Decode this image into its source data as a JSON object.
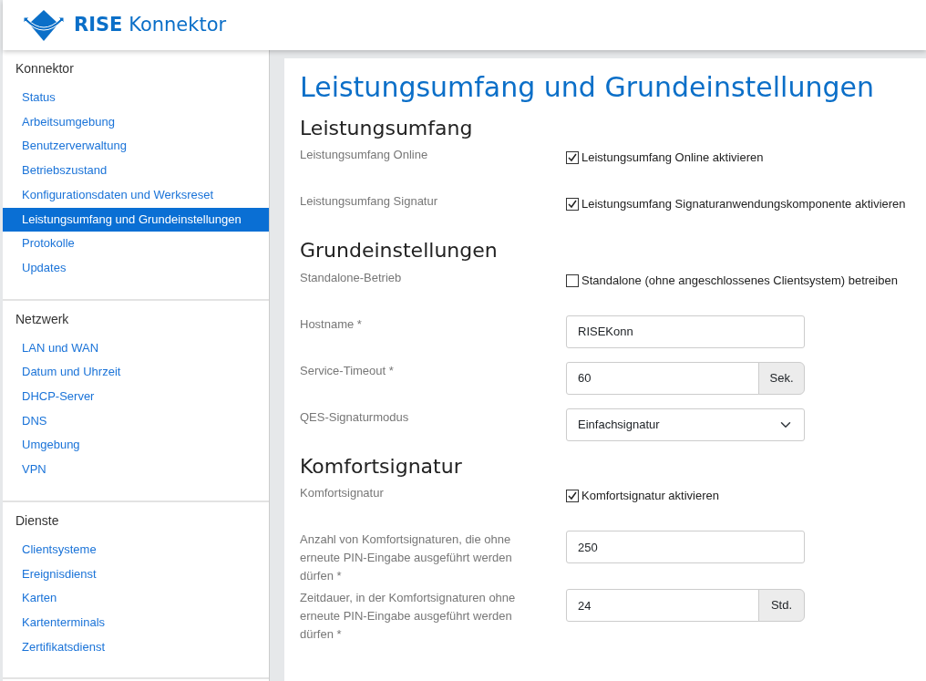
{
  "header": {
    "brand_bold": "RISE",
    "brand": "Konnektor"
  },
  "sidebar": [
    {
      "title": "Konnektor",
      "items": [
        {
          "label": "Status",
          "selected": false
        },
        {
          "label": "Arbeitsumgebung",
          "selected": false
        },
        {
          "label": "Benutzerverwaltung",
          "selected": false
        },
        {
          "label": "Betriebszustand",
          "selected": false
        },
        {
          "label": "Konfigurationsdaten und Werksreset",
          "selected": false
        },
        {
          "label": "Leistungsumfang und Grundeinstellungen",
          "selected": true
        },
        {
          "label": "Protokolle",
          "selected": false
        },
        {
          "label": "Updates",
          "selected": false
        }
      ]
    },
    {
      "title": "Netzwerk",
      "items": [
        {
          "label": "LAN und WAN",
          "selected": false
        },
        {
          "label": "Datum und Uhrzeit",
          "selected": false
        },
        {
          "label": "DHCP-Server",
          "selected": false
        },
        {
          "label": "DNS",
          "selected": false
        },
        {
          "label": "Umgebung",
          "selected": false
        },
        {
          "label": "VPN",
          "selected": false
        }
      ]
    },
    {
      "title": "Dienste",
      "items": [
        {
          "label": "Clientsysteme",
          "selected": false
        },
        {
          "label": "Ereignisdienst",
          "selected": false
        },
        {
          "label": "Karten",
          "selected": false
        },
        {
          "label": "Kartenterminals",
          "selected": false
        },
        {
          "label": "Zertifikatsdienst",
          "selected": false
        }
      ]
    }
  ],
  "page_title": "Leistungsumfang und Grundeinstellungen",
  "sections": [
    {
      "heading": "Leistungsumfang",
      "rows": [
        {
          "label": "Leistungsumfang Online",
          "kind": "checkbox",
          "text": "Leistungsumfang Online aktivieren",
          "checked": true
        },
        {
          "label": "Leistungsumfang Signatur",
          "kind": "checkbox",
          "text": "Leistungsumfang Signaturanwendungskomponente aktivieren",
          "checked": true
        }
      ]
    },
    {
      "heading": "Grundeinstellungen",
      "rows": [
        {
          "label": "Standalone-Betrieb",
          "kind": "checkbox",
          "text": "Standalone (ohne angeschlossenes Clientsystem) betreiben",
          "checked": false
        },
        {
          "label": "Hostname *",
          "kind": "text",
          "value": "RISEKonn"
        },
        {
          "label": "Service-Timeout *",
          "kind": "addon",
          "value": "60",
          "unit": "Sek."
        },
        {
          "label": "QES-Signaturmodus",
          "kind": "select",
          "value": "Einfachsignatur"
        }
      ]
    },
    {
      "heading": "Komfortsignatur",
      "rows": [
        {
          "label": "Komfortsignatur",
          "kind": "checkbox",
          "text": "Komfortsignatur aktivieren",
          "checked": true
        },
        {
          "label": "Anzahl von Komfortsignaturen, die ohne erneute PIN-Eingabe ausgeführt werden dürfen *",
          "kind": "text",
          "value": "250"
        },
        {
          "label": "Zeitdauer, in der Komfortsignaturen ohne erneute PIN-Eingabe ausgeführt werden dürfen *",
          "kind": "addon",
          "value": "24",
          "unit": "Std."
        }
      ]
    }
  ]
}
